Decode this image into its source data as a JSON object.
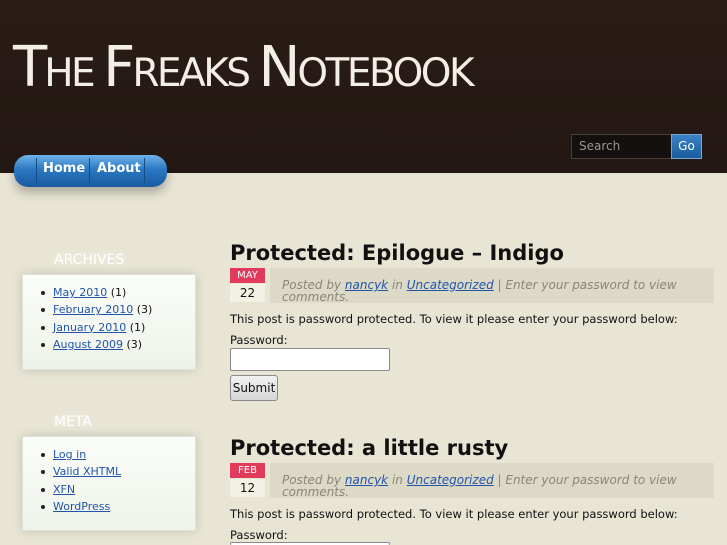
{
  "site": {
    "title_first": "T",
    "title_rest_1": "HE ",
    "title_first_2": "F",
    "title_rest_2": "REAKS ",
    "title_first_3": "N",
    "title_rest_3": "OTEBOOK"
  },
  "search": {
    "placeholder": "Search",
    "button_label": "Go"
  },
  "nav": {
    "items": [
      {
        "label": "Home"
      },
      {
        "label": "About"
      }
    ]
  },
  "sidebar": {
    "archives": {
      "title": "ARCHIVES",
      "items": [
        {
          "link": "May 2010",
          "count": "(1)"
        },
        {
          "link": "February 2010",
          "count": "(3)"
        },
        {
          "link": "January 2010",
          "count": "(1)"
        },
        {
          "link": "August 2009",
          "count": "(3)"
        }
      ]
    },
    "meta": {
      "title": "META",
      "items": [
        {
          "link": "Log in"
        },
        {
          "link": "Valid XHTML"
        },
        {
          "link": "XFN"
        },
        {
          "link": "WordPress"
        }
      ]
    }
  },
  "posts": [
    {
      "title": "Protected: Epilogue – Indigo",
      "month": "MAY",
      "day": "22",
      "posted_by": "Posted by",
      "author": "nancyk",
      "in": "in",
      "category": "Uncategorized",
      "after": "| Enter your password to view comments.",
      "body": "This post is password protected. To view it please enter your password below:",
      "password_label": "Password:",
      "submit_label": "Submit"
    },
    {
      "title": "Protected: a little rusty",
      "month": "FEB",
      "day": "12",
      "posted_by": "Posted by",
      "author": "nancyk",
      "in": "in",
      "category": "Uncategorized",
      "after": "| Enter your password to view comments.",
      "body": "This post is password protected. To view it please enter your password below:",
      "password_label": "Password:"
    }
  ]
}
